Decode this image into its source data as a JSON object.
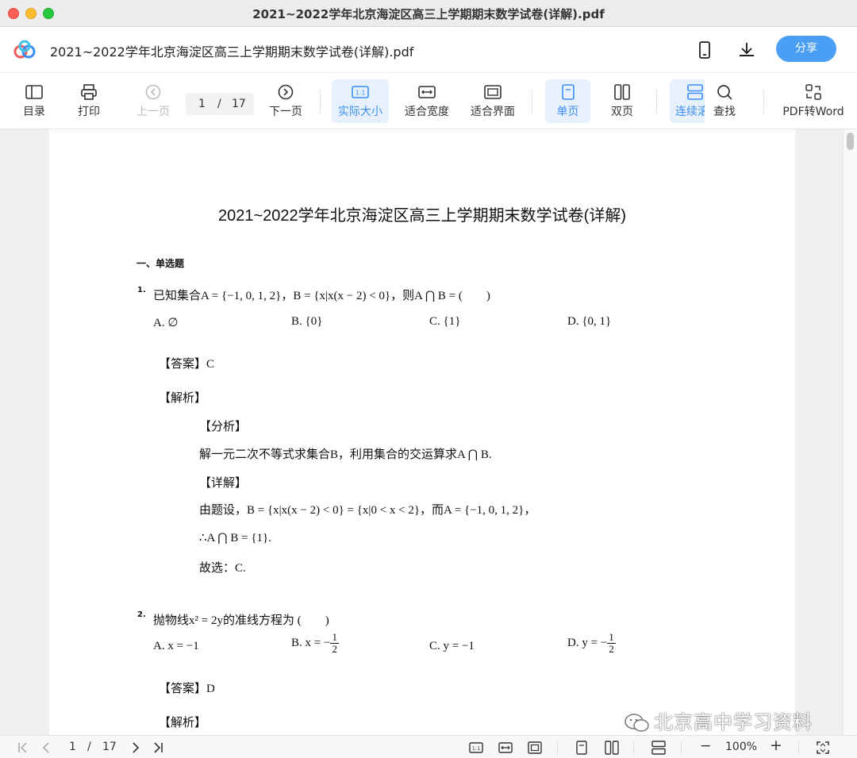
{
  "window": {
    "title": "2021~2022学年北京海淀区高三上学期期末数学试卷(详解).pdf"
  },
  "header": {
    "doc_name": "2021~2022学年北京海淀区高三上学期期末数学试卷(详解).pdf",
    "share_label": "分享",
    "icons": [
      "app-logo-icon",
      "phone-icon",
      "download-icon"
    ]
  },
  "toolbar": {
    "toc": "目录",
    "print": "打印",
    "prev_page": "上一页",
    "page_current": "1",
    "page_sep": "/",
    "page_total": "17",
    "next_page": "下一页",
    "actual_size": "实际大小",
    "fit_width": "适合宽度",
    "fit_window": "适合界面",
    "single_page": "单页",
    "double_page": "双页",
    "continuous": "连续滚",
    "search": "查找",
    "pdf_to_word": "PDF转Word",
    "active_color": "#3d8ef0"
  },
  "document": {
    "title": "2021~2022学年北京海淀区高三上学期期末数学试卷(详解)",
    "section": "一、单选题",
    "q1": {
      "num": "1.",
      "text": "已知集合A = {−1, 0, 1, 2}，B = {x|x(x − 2) < 0}，则A ⋂ B = (　　)",
      "options": [
        "A. ∅",
        "B. {0}",
        "C. {1}",
        "D. {0, 1}"
      ],
      "answer": "【答案】C",
      "analysis_heading": "【解析】",
      "fenxi": "【分析】",
      "fenxi_text": "解一元二次不等式求集合B，利用集合的交运算求A ⋂ B.",
      "xiangjie": "【详解】",
      "line1": "由题设，B = {x|x(x − 2) < 0} = {x|0 < x < 2}，而A = {−1, 0, 1, 2}，",
      "line2": "∴A ⋂ B = {1}.",
      "line3": "故选：C."
    },
    "q2": {
      "num": "2.",
      "text": "抛物线x² = 2y的准线方程为 (　　)",
      "options": {
        "a": "A. x = −1",
        "b_prefix": "B. x = −",
        "c": "C. y = −1",
        "d_prefix": "D. y = −",
        "frac_num": "1",
        "frac_den": "2"
      },
      "answer": "【答案】D",
      "analysis_heading": "【解析】"
    },
    "watermark": "北京高中学习资料"
  },
  "bottombar": {
    "page_current": "1",
    "page_sep": "/",
    "page_total": "17",
    "zoom_minus": "−",
    "zoom": "100%",
    "zoom_plus": "+"
  }
}
